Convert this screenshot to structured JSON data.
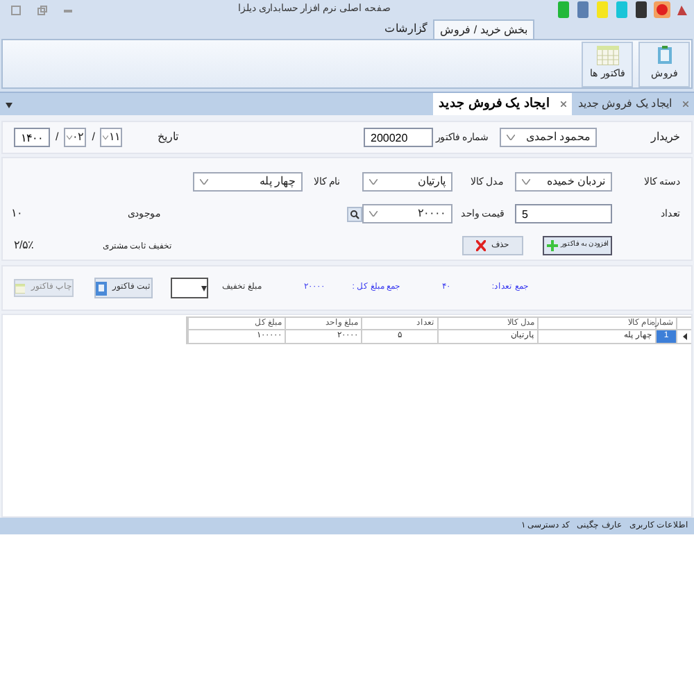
{
  "window": {
    "title": "صفحه اصلی نرم افزار حسابداری دیلزا"
  },
  "ribbon_tabs": [
    {
      "label": "بخش خرید / فروش",
      "selected": true
    },
    {
      "label": "گزارشات",
      "selected": false
    }
  ],
  "ribbon_buttons": [
    {
      "label": "فروش",
      "kind": "sale"
    },
    {
      "label": "فاکتور ها",
      "kind": "invoices"
    }
  ],
  "doc_tabs": [
    {
      "label": "ایجاد یک فروش جدید",
      "selected": false
    },
    {
      "label": "ایجاد یک فروش جدید",
      "selected": true
    }
  ],
  "header": {
    "buyer_label": "خریدار",
    "buyer": "محمود احمدی",
    "invoice_label": "شماره فاکتور",
    "invoice": "200020",
    "date_label": "تاریخ",
    "day": "۱۱",
    "month": "۰۲",
    "year": "۱۴۰۰",
    "separator": "/"
  },
  "item": {
    "category_label": "دسته کالا",
    "category": "نردبان خمیده",
    "model_label": "مدل کالا",
    "model": "پارتیان",
    "name_label": "نام کالا",
    "name": "چهار پله",
    "qty_label": "تعداد",
    "qty": "5",
    "price_label": "قیمت واحد",
    "price": "۲۰۰۰۰",
    "stock_label": "موجودی",
    "stock": "۱۰",
    "add_button": "افزودن به فاکتور",
    "delete_button": "حذف",
    "discount_label": "تخفیف ثابت مشتری",
    "discount": "۲/۵٪"
  },
  "totals": {
    "count_label": "جمع تعداد:",
    "count": "۴۰",
    "sum_label": "جمع مبلغ کل :",
    "sum": "۲۰۰۰۰",
    "discount_label": "مبلغ تخفیف",
    "save_button": "ثبت فاکتور",
    "print_button": "چاپ فاکتور"
  },
  "table": {
    "columns": [
      "شماره",
      "نام کالا",
      "مدل کالا",
      "تعداد",
      "مبلغ واحد",
      "مبلغ کل"
    ],
    "rows": [
      {
        "selected": true,
        "cells": [
          "1",
          "چهار پله",
          "پارتیان",
          "۵",
          "۲۰۰۰۰",
          "۱۰۰۰۰۰"
        ]
      }
    ]
  },
  "status_bar": [
    "اطلاعات کاربری",
    "عارف چگینی",
    "کد دسترسی ۱"
  ]
}
